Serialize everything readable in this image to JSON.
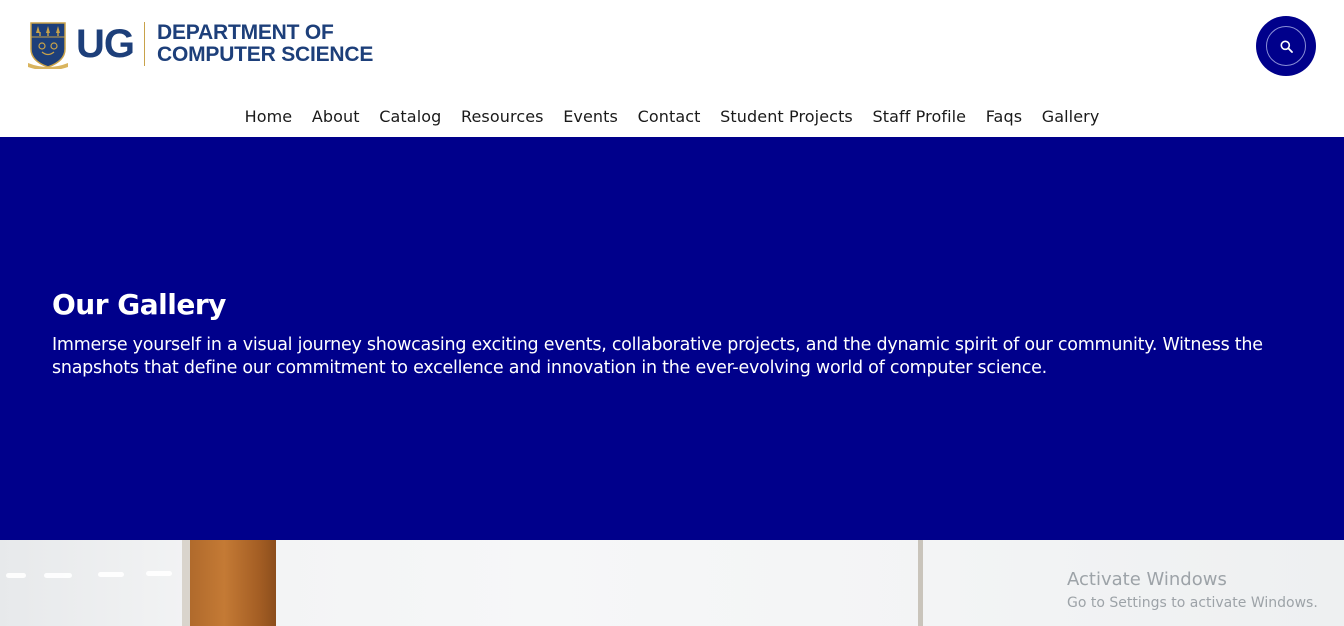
{
  "header": {
    "logo": {
      "short_name": "UG",
      "dept_line1": "DEPARTMENT OF",
      "dept_line2": "COMPUTER SCIENCE"
    },
    "search_icon": "search-icon",
    "nav": [
      {
        "label": "Home"
      },
      {
        "label": "About"
      },
      {
        "label": "Catalog"
      },
      {
        "label": "Resources"
      },
      {
        "label": "Events"
      },
      {
        "label": "Contact"
      },
      {
        "label": "Student Projects"
      },
      {
        "label": "Staff Profile"
      },
      {
        "label": "Faqs"
      },
      {
        "label": "Gallery"
      }
    ]
  },
  "hero": {
    "title": "Our Gallery",
    "description": "Immerse yourself in a visual journey showcasing exciting events, collaborative projects, and the dynamic spirit of our community. Witness the snapshots that define our commitment to excellence and innovation in the ever-evolving world of computer science."
  },
  "watermark": {
    "title": "Activate Windows",
    "subtitle": "Go to Settings to activate Windows."
  },
  "colors": {
    "primary": "#00008b",
    "logo_blue": "#1d3f7a",
    "logo_gold": "#c8a24a"
  }
}
